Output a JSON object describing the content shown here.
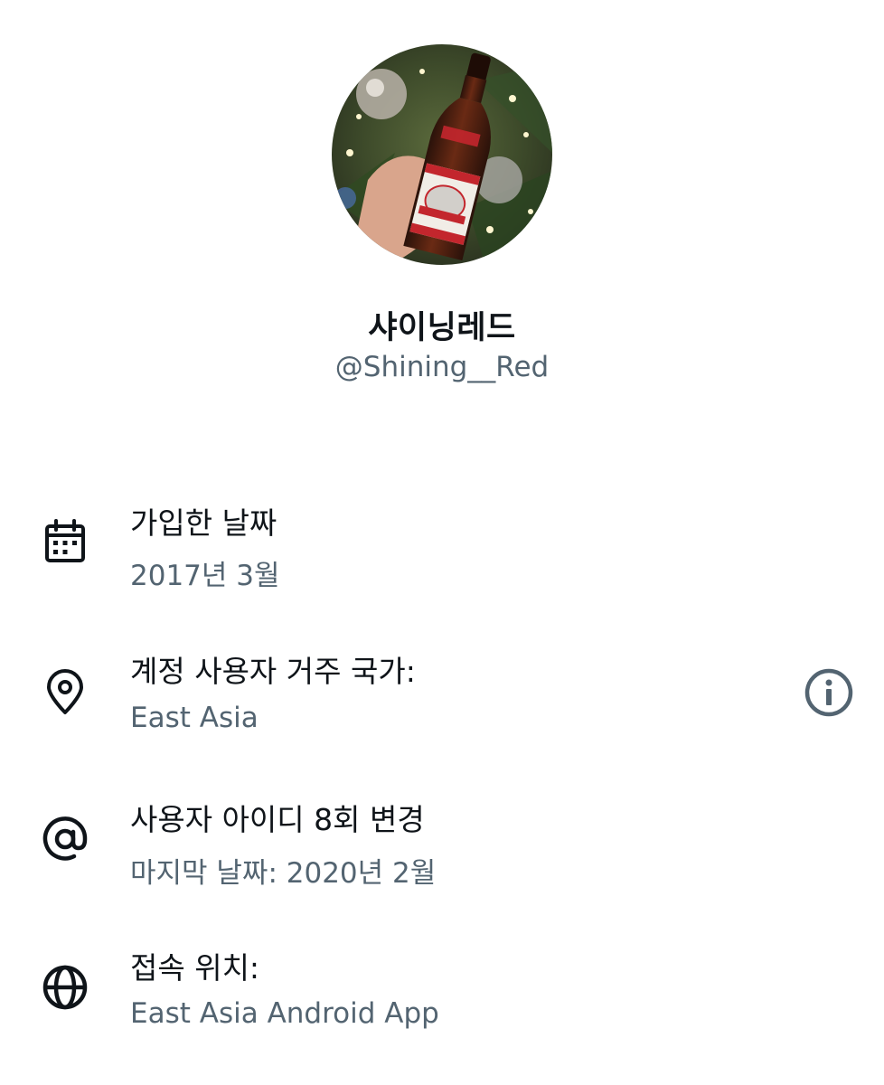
{
  "profile": {
    "display_name": "샤이닝레드",
    "handle": "@Shining__Red"
  },
  "about": [
    {
      "icon": "calendar-icon",
      "title": "가입한 날짜",
      "subtitle": "2017년 3월"
    },
    {
      "icon": "location-pin-icon",
      "title": "계정 사용자 거주 국가:",
      "subtitle": "East Asia",
      "action_icon": "info-icon"
    },
    {
      "icon": "at-sign-icon",
      "title": "사용자 아이디 8회 변경",
      "subtitle": "마지막 날짜: 2020년 2월"
    },
    {
      "icon": "globe-icon",
      "title": "접속 위치:",
      "subtitle": "East Asia Android App"
    }
  ],
  "colors": {
    "primary_text": "#0f1419",
    "secondary_text": "#536471"
  }
}
